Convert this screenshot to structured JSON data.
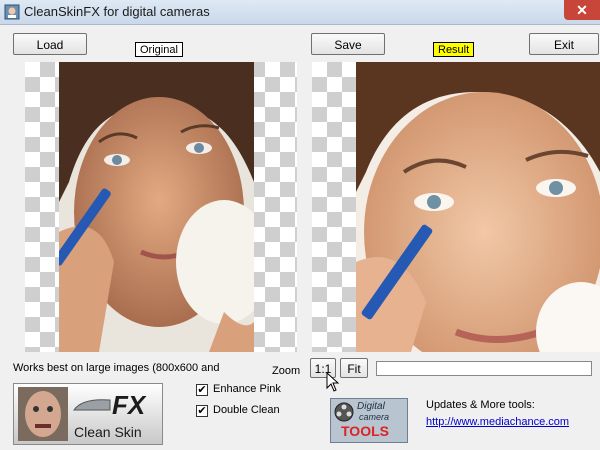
{
  "window": {
    "title": "CleanSkinFX for digital cameras",
    "close_glyph": "✕"
  },
  "toolbar": {
    "load_label": "Load",
    "save_label": "Save",
    "exit_label": "Exit"
  },
  "panels": {
    "original_label": "Original",
    "result_label": "Result",
    "result_label_color": "#ffff00"
  },
  "status": {
    "works_best_text": "Works best on large images (800x600 and"
  },
  "zoom": {
    "label": "Zoom",
    "one_to_one_label": "1:1",
    "fit_label": "Fit"
  },
  "options": {
    "enhance_pink": {
      "label": "Enhance Pink",
      "checked": true,
      "mark": "✔"
    },
    "double_clean": {
      "label": "Double Clean",
      "checked": true,
      "mark": "✔"
    }
  },
  "logo": {
    "fx_text": "FX",
    "clean_skin_text": "Clean Skin"
  },
  "dct_logo": {
    "line1": "Digital",
    "line2": "camera",
    "tools": "TOOLS"
  },
  "updates": {
    "label": "Updates & More tools:",
    "link": "http://www.mediachance.com"
  },
  "icons": [
    "app-icon",
    "close-icon",
    "mouse-pointer-icon",
    "film-reel-icon",
    "face-icon"
  ]
}
